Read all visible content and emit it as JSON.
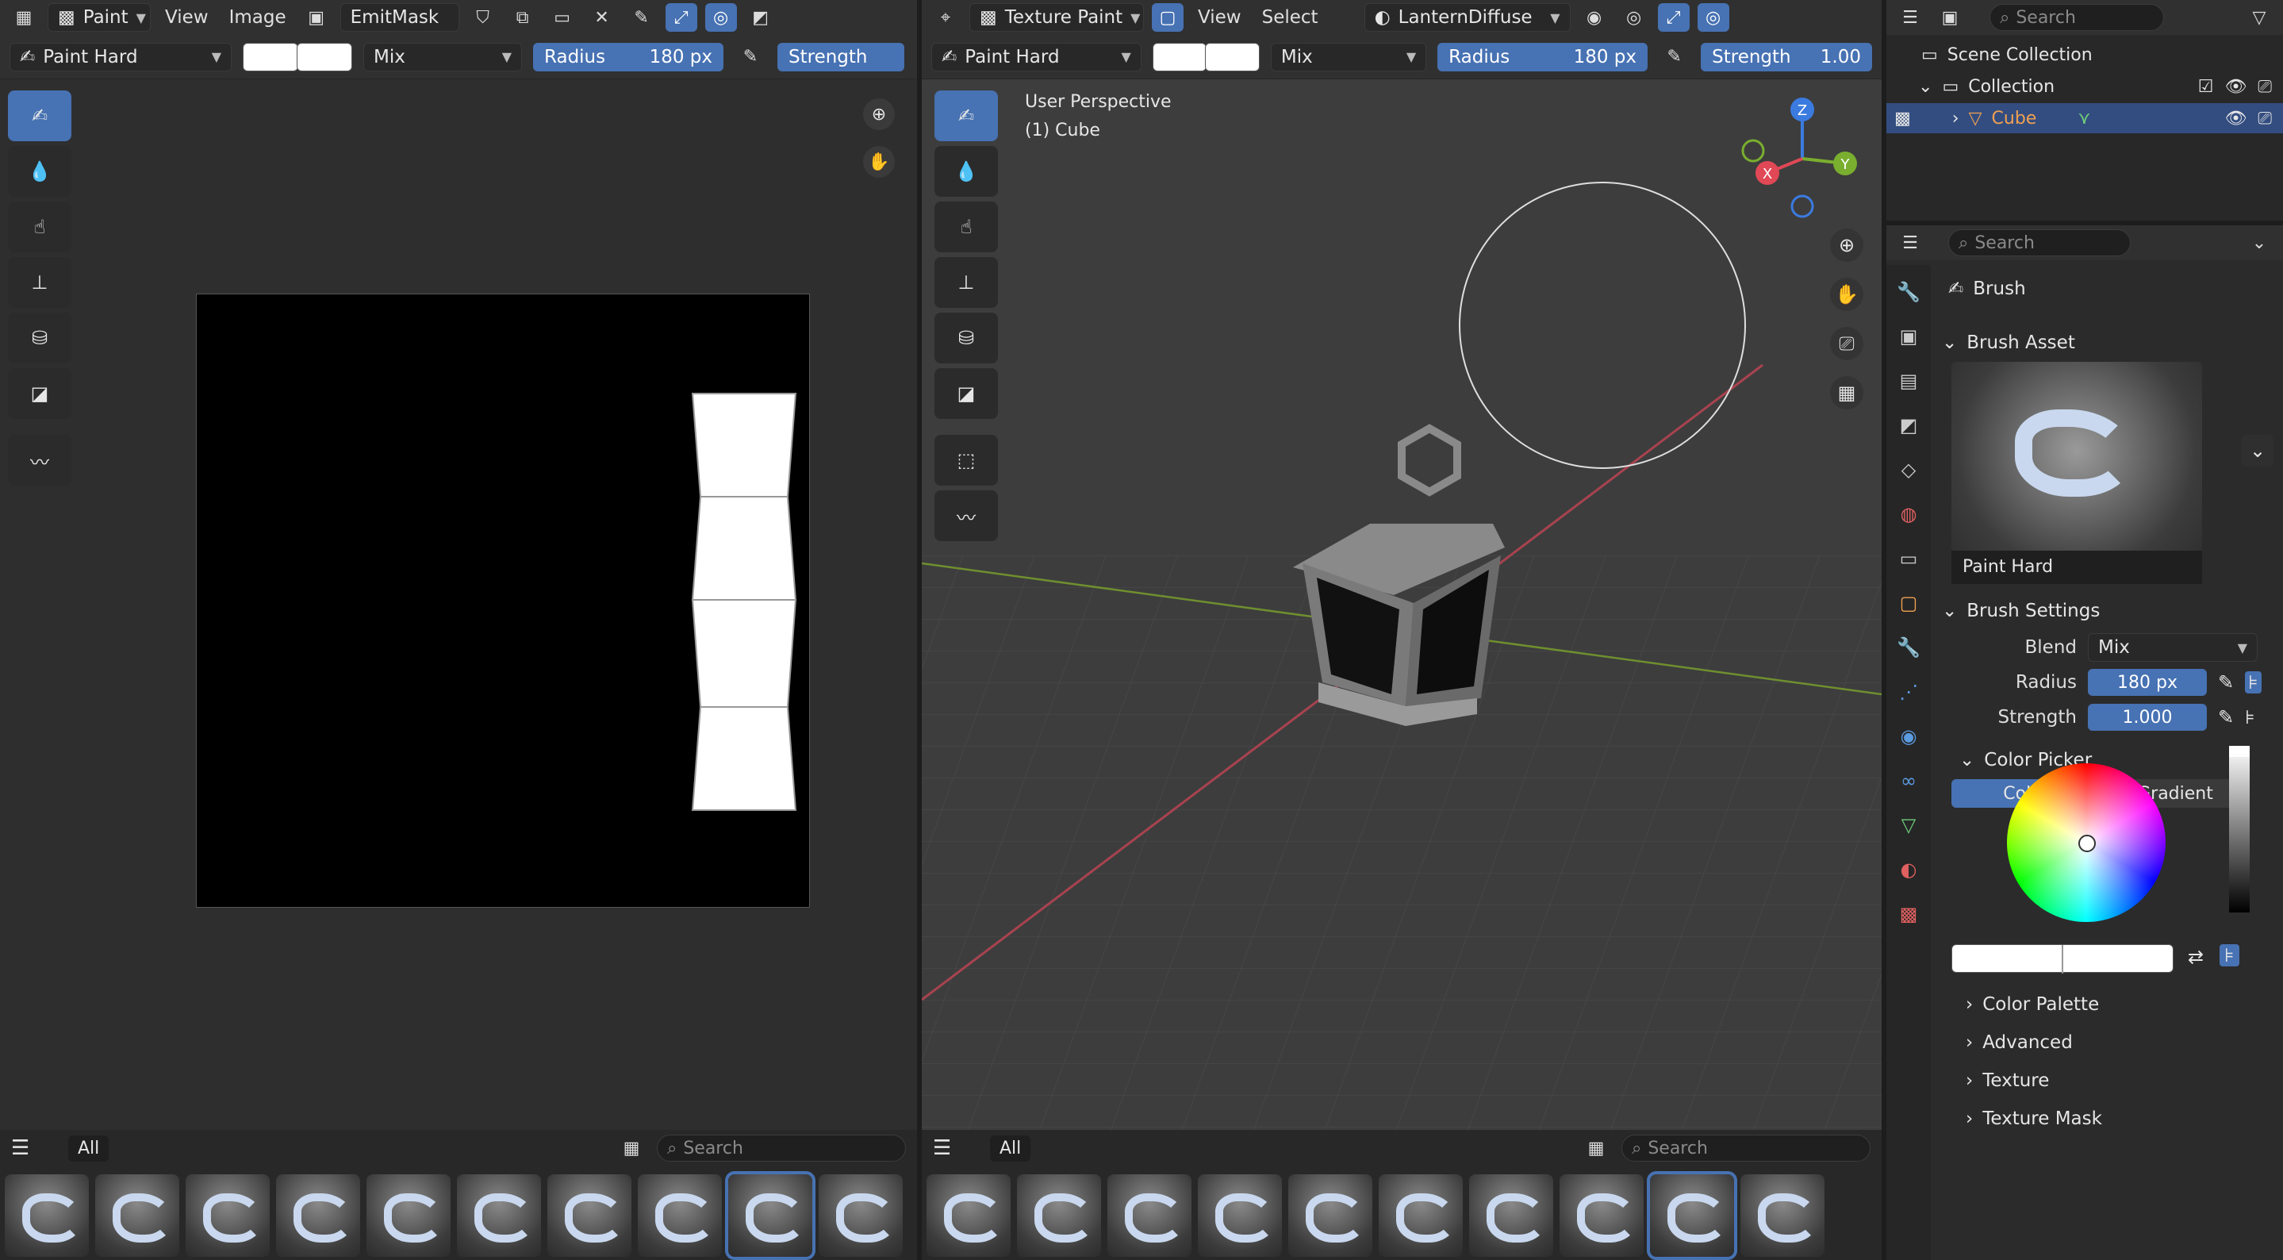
{
  "image_editor": {
    "header": {
      "mode": "Paint",
      "menus": [
        "View",
        "Image"
      ],
      "image_name": "EmitMask"
    },
    "toolsettings": {
      "brush": "Paint Hard",
      "blend": "Mix",
      "radius_label": "Radius",
      "radius_value": "180 px",
      "strength_label": "Strength"
    }
  },
  "viewport": {
    "header": {
      "mode": "Texture Paint",
      "menus": [
        "View",
        "Select"
      ],
      "material": "LanternDiffuse"
    },
    "toolsettings": {
      "brush": "Paint Hard",
      "blend": "Mix",
      "radius_label": "Radius",
      "radius_value": "180 px",
      "strength_label": "Strength",
      "strength_value": "1.00"
    },
    "overlay": {
      "perspective": "User Perspective",
      "object": "(1) Cube"
    },
    "gizmo": {
      "x": "X",
      "y": "Y",
      "z": "Z"
    }
  },
  "asset_shelf": {
    "tab": "All",
    "search_placeholder": "Search"
  },
  "outliner": {
    "search_placeholder": "Search",
    "scene_collection": "Scene Collection",
    "collection": "Collection",
    "object": "Cube"
  },
  "properties": {
    "search_placeholder": "Search",
    "title": "Brush",
    "brush_asset_label": "Brush Asset",
    "brush_preview_name": "Paint Hard",
    "brush_settings_label": "Brush Settings",
    "blend_label": "Blend",
    "blend_value": "Mix",
    "radius_label": "Radius",
    "radius_value": "180 px",
    "strength_label": "Strength",
    "strength_value": "1.000",
    "color_picker_label": "Color Picker",
    "color_tab": "Color",
    "gradient_tab": "Gradient",
    "collapsed": [
      "Color Palette",
      "Advanced",
      "Texture",
      "Texture Mask"
    ]
  },
  "colors": {
    "accent": "#4772b3",
    "bg": "#303030",
    "panel": "#282828"
  }
}
